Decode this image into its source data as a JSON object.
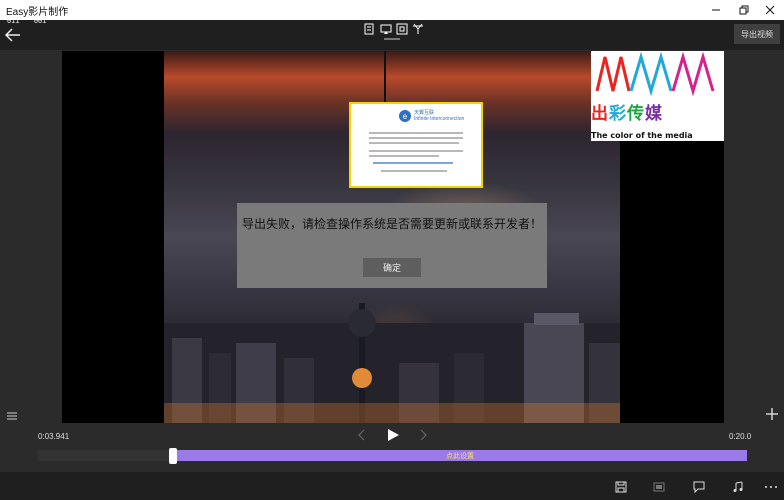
{
  "window": {
    "title": "Easy影片制作"
  },
  "debug": {
    "left": "011",
    "right": "001"
  },
  "toolbar": {
    "export_label": "导出视频"
  },
  "video": {
    "media_logo_chars": [
      "出",
      "彩",
      "传",
      "媒"
    ],
    "media_logo_colors": [
      "#e8251f",
      "#1fa9d8",
      "#1aa83a",
      "#7a2fa0"
    ],
    "media_logo_english": "The color of the media",
    "inset_title": "天翼互联",
    "inset_subtitle": "Infinite Interconnection"
  },
  "dialog": {
    "message": "导出失败，请检查操作系统是否需要更新或联系开发者！",
    "ok_label": "确定"
  },
  "player": {
    "current_time": "0:03.941",
    "total_time": "0:20.0",
    "position_fraction": 0.191
  },
  "timeline": {
    "clip_label": "点此设置"
  },
  "colors": {
    "accent": "#9c79e8",
    "clip_text": "#f7e26a",
    "dialog_bg": "#7a7a7a",
    "inset_border": "#f2d400"
  }
}
